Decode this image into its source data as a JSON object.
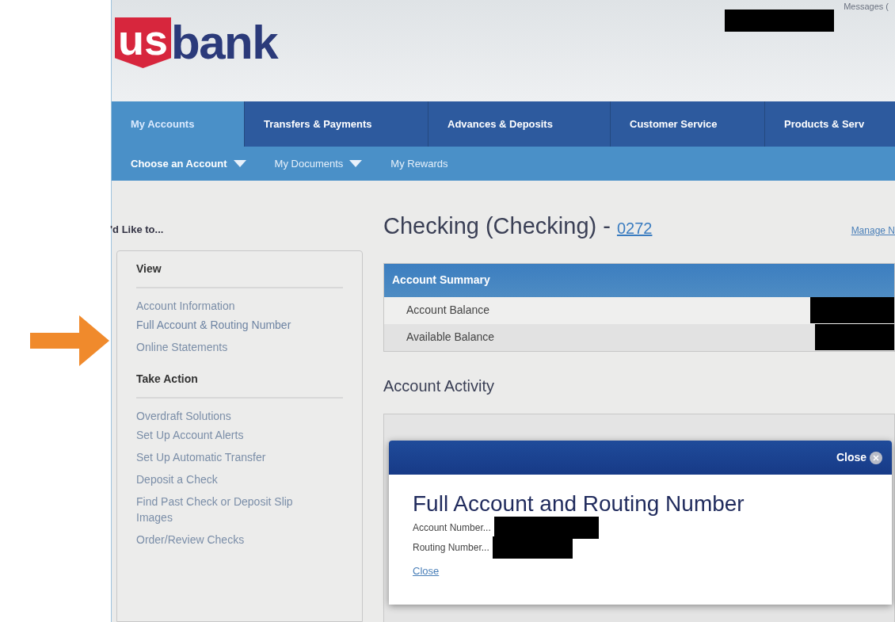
{
  "header": {
    "logo": {
      "mark": "us",
      "word": "bank"
    },
    "top_link": "Messages ("
  },
  "nav": {
    "tabs": [
      {
        "label": "My Accounts",
        "selected": true
      },
      {
        "label": "Transfers & Payments",
        "selected": false
      },
      {
        "label": "Advances & Deposits",
        "selected": false
      },
      {
        "label": "Customer Service",
        "selected": false
      },
      {
        "label": "Products & Serv",
        "selected": false
      }
    ],
    "subnav": [
      {
        "label": "Choose an Account",
        "dropdown": true,
        "selected": true
      },
      {
        "label": "My Documents",
        "dropdown": true,
        "selected": false
      },
      {
        "label": "My Rewards",
        "dropdown": false,
        "selected": false
      }
    ]
  },
  "sidebar": {
    "heading": "'d Like to...",
    "sections": [
      {
        "title": "View",
        "links": [
          {
            "label": "Account Information",
            "highlighted": false
          },
          {
            "label": "Full Account & Routing Number",
            "highlighted": true
          },
          {
            "label": "Online Statements",
            "highlighted": false
          }
        ]
      },
      {
        "title": "Take Action",
        "links": [
          {
            "label": "Overdraft Solutions",
            "highlighted": false
          },
          {
            "label": "Set Up Account Alerts",
            "highlighted": false
          },
          {
            "label": "Set Up Automatic Transfer",
            "highlighted": false
          },
          {
            "label": "Deposit a Check",
            "highlighted": false
          },
          {
            "label": "Find Past Check or Deposit Slip Images",
            "highlighted": false
          },
          {
            "label": "Order/Review Checks",
            "highlighted": false
          }
        ]
      }
    ]
  },
  "account": {
    "title": "Checking (Checking) - ",
    "number": "0272",
    "manage_link": "Manage N"
  },
  "summary": {
    "title": "Account Summary",
    "rows": [
      {
        "label": "Account Balance"
      },
      {
        "label": "Available Balance"
      }
    ]
  },
  "activity": {
    "title": "Account Activity"
  },
  "modal": {
    "close_button": "Close",
    "title": "Full Account and Routing Number",
    "fields": [
      {
        "label": "Account Number..."
      },
      {
        "label": "Routing Number..."
      }
    ],
    "close_link": "Close"
  }
}
